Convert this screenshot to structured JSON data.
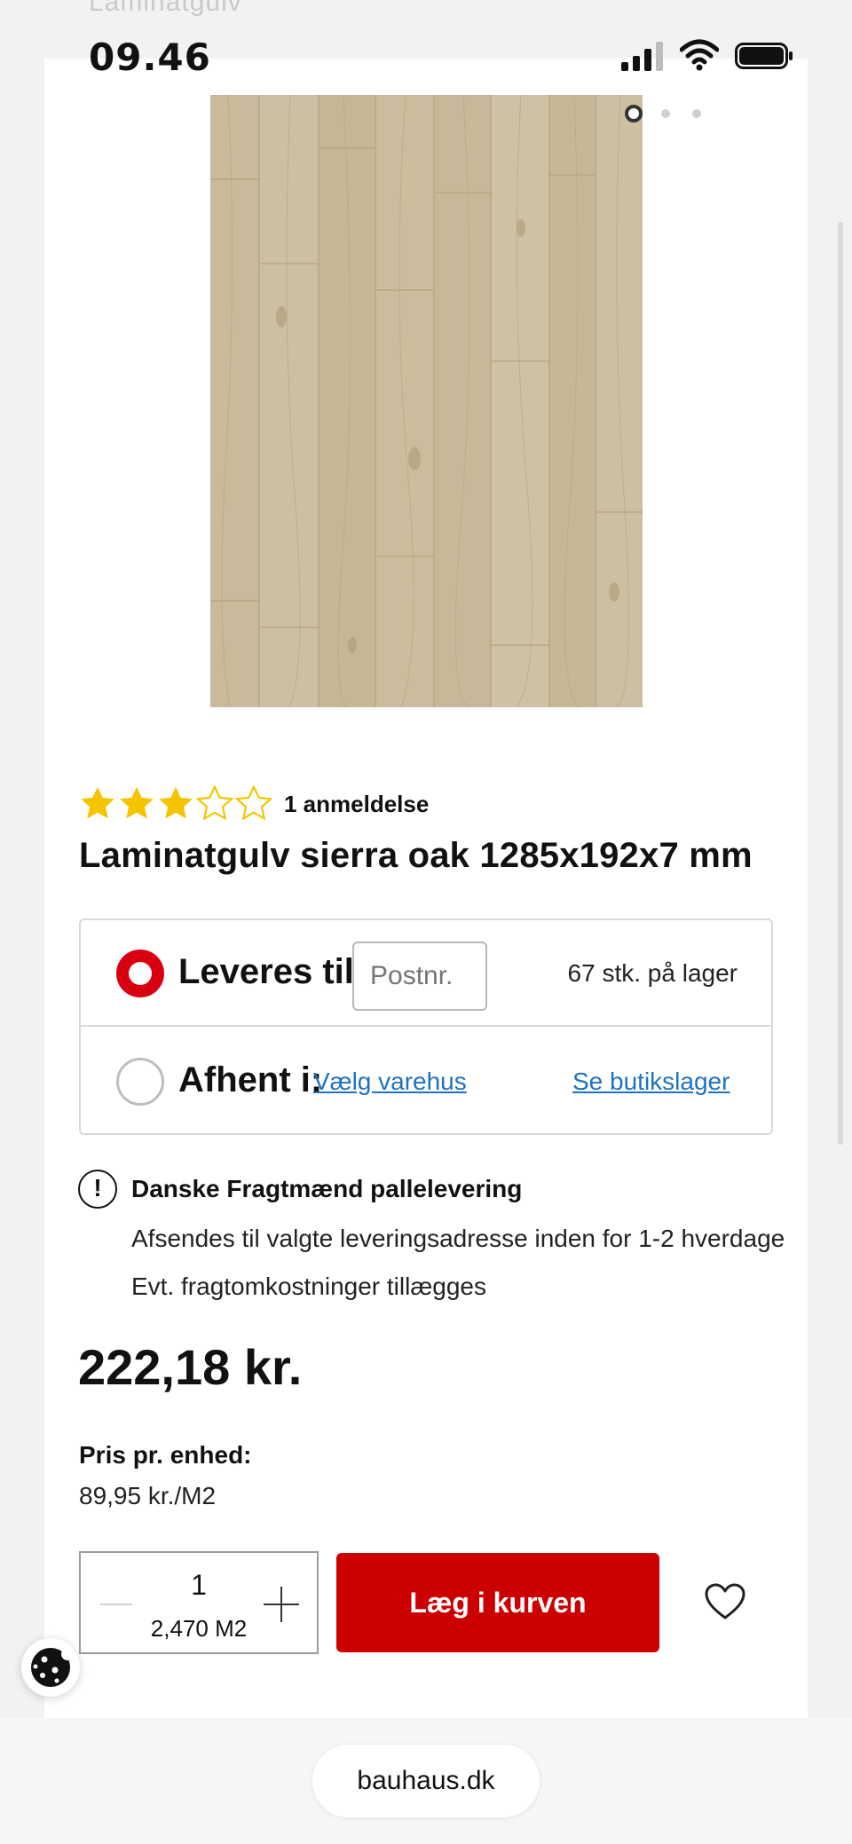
{
  "browser": {
    "ghost_header": "Laminatgulv",
    "time": "09.46",
    "url": "bauhaus.dk"
  },
  "gallery": {
    "image_count": 3,
    "active_index": 0
  },
  "product": {
    "rating_stars": 3,
    "rating_max": 5,
    "review_count": "1 anmeldelse",
    "title": "Laminatgulv sierra oak 1285x192x7 mm"
  },
  "delivery": {
    "deliver_label": "Leveres til:",
    "postnr_placeholder": "Postnr.",
    "stock": "67 stk. på lager",
    "pickup_label": "Afhent i:",
    "choose_store": "Vælg varehus",
    "store_stock": "Se butikslager"
  },
  "shipping": {
    "title": "Danske Fragtmænd pallelevering",
    "line1": "Afsendes til valgte leveringsadresse inden for 1-2 hverdage",
    "line2": "Evt. fragtomkostninger tillægges"
  },
  "pricing": {
    "price": "222,18 kr.",
    "unit_label": "Pris pr. enhed:",
    "unit_price": "89,95 kr./M2"
  },
  "cart": {
    "quantity": "1",
    "area": "2,470 M2",
    "add_label": "Læg i kurven"
  },
  "colors": {
    "accent_red": "#cc0000",
    "link_blue": "#1e73be",
    "star_yellow": "#f5c400"
  }
}
